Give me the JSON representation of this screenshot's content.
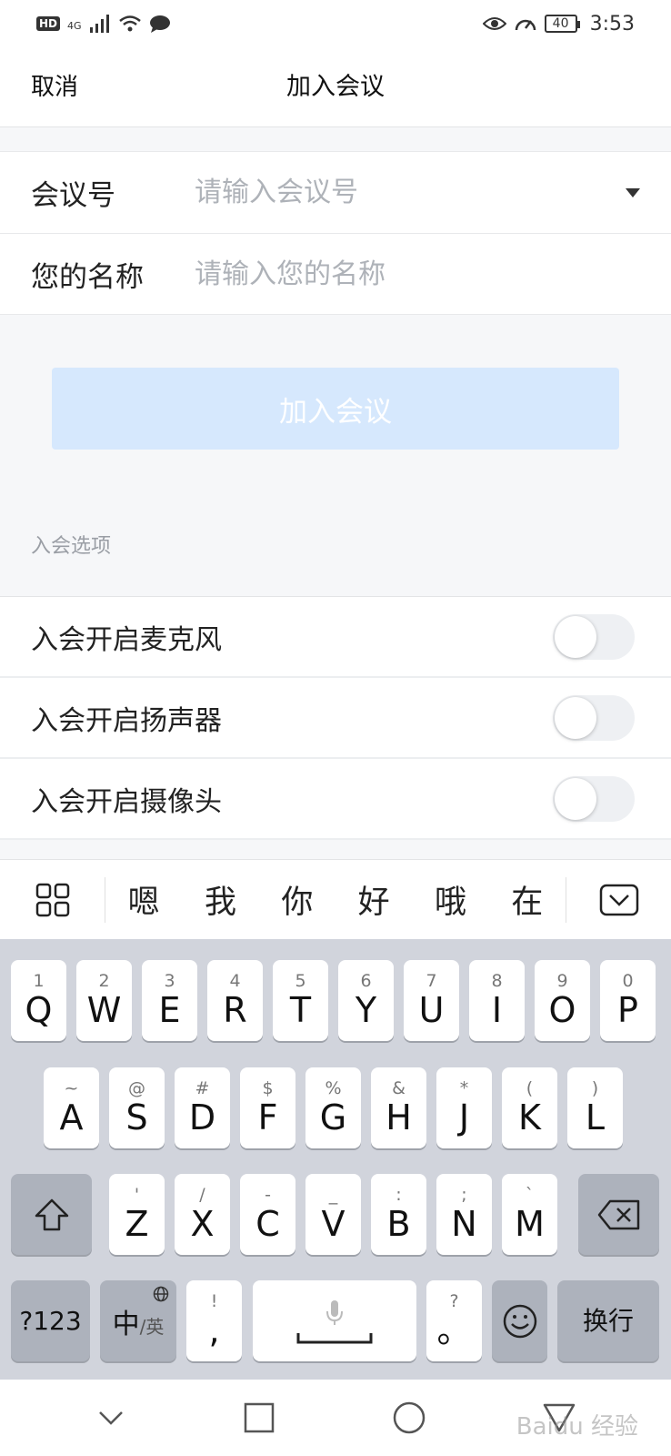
{
  "status_bar": {
    "hd": "HD",
    "network": "4G",
    "battery": "40",
    "time": "3:53"
  },
  "nav": {
    "cancel": "取消",
    "title": "加入会议"
  },
  "form": {
    "meeting_id": {
      "label": "会议号",
      "placeholder": "请输入会议号"
    },
    "name": {
      "label": "您的名称",
      "placeholder": "请输入您的名称"
    }
  },
  "join_button": "加入会议",
  "options": {
    "section_title": "入会选项",
    "items": [
      {
        "label": "入会开启麦克风",
        "enabled": false
      },
      {
        "label": "入会开启扬声器",
        "enabled": false
      },
      {
        "label": "入会开启摄像头",
        "enabled": false
      }
    ]
  },
  "ime": {
    "candidates": [
      "嗯",
      "我",
      "你",
      "好",
      "哦",
      "在"
    ],
    "row1": [
      {
        "sub": "1",
        "main": "Q"
      },
      {
        "sub": "2",
        "main": "W"
      },
      {
        "sub": "3",
        "main": "E"
      },
      {
        "sub": "4",
        "main": "R"
      },
      {
        "sub": "5",
        "main": "T"
      },
      {
        "sub": "6",
        "main": "Y"
      },
      {
        "sub": "7",
        "main": "U"
      },
      {
        "sub": "8",
        "main": "I"
      },
      {
        "sub": "9",
        "main": "O"
      },
      {
        "sub": "0",
        "main": "P"
      }
    ],
    "row2": [
      {
        "sub": "~",
        "main": "A"
      },
      {
        "sub": "@",
        "main": "S"
      },
      {
        "sub": "#",
        "main": "D"
      },
      {
        "sub": "$",
        "main": "F"
      },
      {
        "sub": "%",
        "main": "G"
      },
      {
        "sub": "&",
        "main": "H"
      },
      {
        "sub": "*",
        "main": "J"
      },
      {
        "sub": "(",
        "main": "K"
      },
      {
        "sub": ")",
        "main": "L"
      }
    ],
    "row3": [
      {
        "sub": "'",
        "main": "Z"
      },
      {
        "sub": "/",
        "main": "X"
      },
      {
        "sub": "-",
        "main": "C"
      },
      {
        "sub": "_",
        "main": "V"
      },
      {
        "sub": ":",
        "main": "B"
      },
      {
        "sub": ";",
        "main": "N"
      },
      {
        "sub": "`",
        "main": "M"
      }
    ],
    "symbols_key": "?123",
    "lang_key_main": "中",
    "lang_key_sub": "/英",
    "comma_key": {
      "sub": "!",
      "main": ","
    },
    "period_key": {
      "sub": "?",
      "main": "。"
    },
    "enter_key": "换行"
  },
  "watermark": "Baidu 经验"
}
